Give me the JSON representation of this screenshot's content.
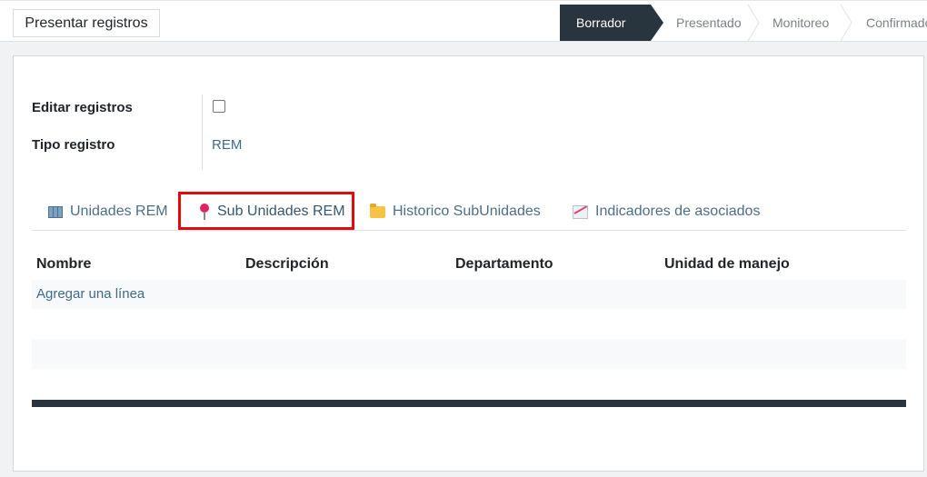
{
  "toolbar": {
    "present_button": "Presentar registros"
  },
  "status_steps": [
    {
      "label": "Borrador",
      "active": true
    },
    {
      "label": "Presentado",
      "active": false
    },
    {
      "label": "Monitoreo",
      "active": false
    },
    {
      "label": "Confirmado",
      "active": false
    }
  ],
  "form": {
    "edit_label": "Editar registros",
    "edit_checked": false,
    "tipo_label": "Tipo registro",
    "tipo_value": "REM"
  },
  "tabs": [
    {
      "label": "Unidades REM",
      "icon": "map-icon"
    },
    {
      "label": "Sub Unidades REM",
      "icon": "pin-icon",
      "highlighted": true
    },
    {
      "label": "Historico SubUnidades",
      "icon": "folder-icon"
    },
    {
      "label": "Indicadores de asociados",
      "icon": "chart-icon"
    }
  ],
  "table": {
    "columns": [
      "Nombre",
      "Descripción",
      "Departamento",
      "Unidad de manejo"
    ],
    "add_line": "Agregar una línea"
  },
  "colors": {
    "status_active_bg": "#28343e",
    "link": "#3d6b86",
    "highlight": "#e10b0b"
  }
}
